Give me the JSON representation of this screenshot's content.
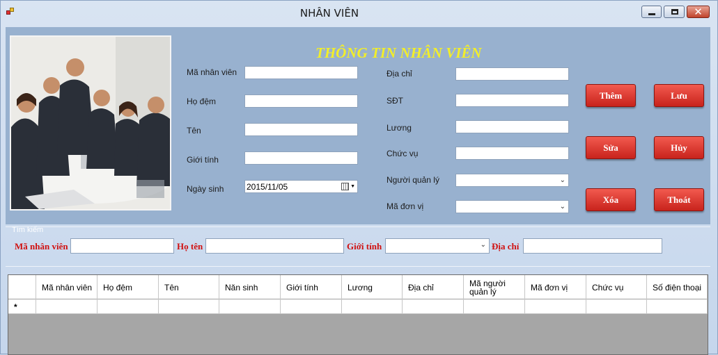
{
  "window": {
    "title": "NHÂN VIÊN",
    "close_glyph": "✕"
  },
  "form": {
    "heading": "THÔNG TIN NHÂN VIÊN",
    "left_fields": [
      {
        "label": "Mã nhân viên",
        "value": ""
      },
      {
        "label": "Họ đệm",
        "value": ""
      },
      {
        "label": "Tên",
        "value": ""
      },
      {
        "label": "Giới tính",
        "value": ""
      },
      {
        "label": "Ngày sinh",
        "value": "2015/11/05"
      }
    ],
    "right_fields": [
      {
        "label": "Địa chỉ",
        "value": ""
      },
      {
        "label": "SĐT",
        "value": ""
      },
      {
        "label": "Lương",
        "value": ""
      },
      {
        "label": "Chức vụ",
        "value": ""
      },
      {
        "label": "Người quản lý",
        "value": ""
      },
      {
        "label": "Mã đơn vị",
        "value": ""
      }
    ]
  },
  "buttons": {
    "add": "Thêm",
    "save": "Lưu",
    "edit": "Sửa",
    "cancel": "Hủy",
    "delete": "Xóa",
    "exit": "Thoát"
  },
  "search": {
    "legend": "Tìm kiếm",
    "employee_id_label": "Mã nhân viên",
    "fullname_label": "Họ tên",
    "gender_label": "Giới tính",
    "address_label": "Địa chỉ"
  },
  "grid": {
    "columns": [
      "Mã nhân viên",
      "Họ đệm",
      "Tên",
      "Năn sinh",
      "Giới tính",
      "Lương",
      "Địa chỉ",
      "Mã người quản lý",
      "Mã đơn vị",
      "Chức vụ",
      "Số điện thoại"
    ],
    "new_row_marker": "*"
  },
  "colors": {
    "panel": "#98b1cf",
    "heading": "#f2ee2a",
    "button": "#d9312a",
    "search_label": "#d01010"
  },
  "icons": [
    "app-icon",
    "minimize-icon",
    "maximize-icon",
    "close-icon",
    "calendar-icon",
    "dropdown-arrow-icon"
  ]
}
